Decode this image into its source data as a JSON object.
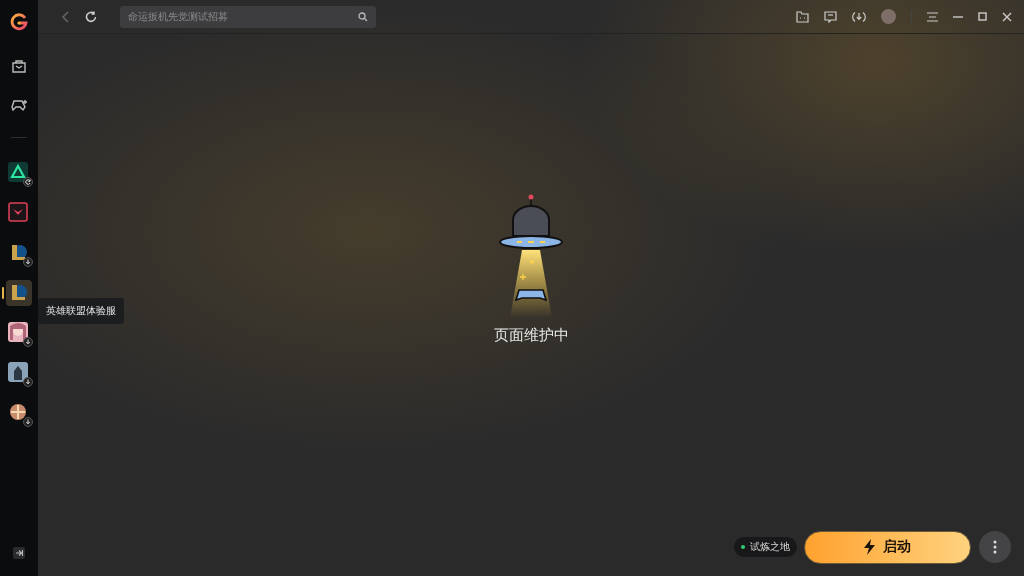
{
  "sidebar": {
    "nav": [
      {
        "kind": "bag"
      },
      {
        "kind": "gamepad"
      }
    ],
    "games": [
      {
        "kind": "triangle",
        "update_badge": true,
        "download_badge": false,
        "selected": false
      },
      {
        "kind": "chevron",
        "update_badge": false,
        "download_badge": false,
        "selected": false
      },
      {
        "kind": "league",
        "update_badge": false,
        "download_badge": true,
        "selected": false
      },
      {
        "kind": "league",
        "update_badge": false,
        "download_badge": false,
        "selected": true
      },
      {
        "kind": "portrait",
        "update_badge": false,
        "download_badge": true,
        "selected": false
      },
      {
        "kind": "knight",
        "update_badge": false,
        "download_badge": true,
        "selected": false
      },
      {
        "kind": "emblem",
        "update_badge": false,
        "download_badge": true,
        "selected": false
      }
    ],
    "tooltip": "英雄联盟体验服"
  },
  "toolbar": {
    "search": {
      "placeholder": "命运扳机先觉测试招募"
    }
  },
  "content": {
    "message": "页面维护中"
  },
  "launch": {
    "server": {
      "name": "试炼之地",
      "color": "#2ecc71"
    },
    "button": "启动"
  }
}
